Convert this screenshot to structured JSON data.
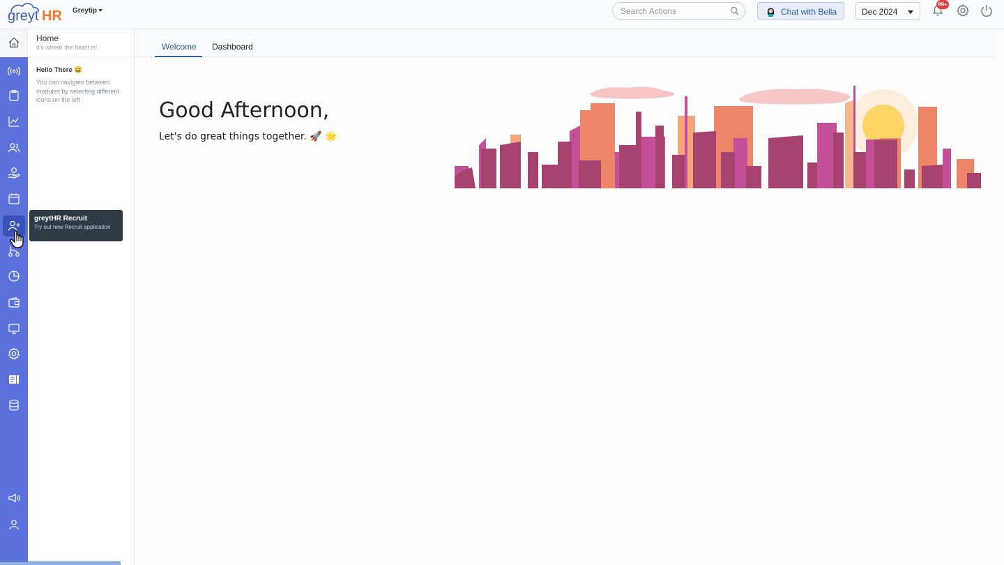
{
  "header": {
    "logo_text_a": "greyt",
    "logo_text_b": "HR",
    "org_name": "Greytip",
    "search_placeholder": "Search Actions",
    "chat_label": "Chat with Bella",
    "month_value": "Dec 2024",
    "notification_badge": "99+"
  },
  "sidebar": {
    "icons": [
      "home-icon",
      "broadcast-icon",
      "clipboard-icon",
      "chart-line-icon",
      "people-icon",
      "hand-coin-icon",
      "calendar-icon",
      "user-add-icon",
      "flow-icon",
      "pie-chart-icon",
      "wallet-icon",
      "monitor-icon",
      "settings-cog-icon",
      "document-list-icon",
      "database-icon",
      "megaphone-icon",
      "user-icon"
    ],
    "active": "user-add-icon"
  },
  "panel": {
    "title": "Home",
    "subtitle": "it's where the heart is!",
    "hello": "Hello There 😀",
    "description": "You can navigate between modules by selecting different icons on the left"
  },
  "tooltip": {
    "title": "greytHR Recruit",
    "description": "Try out new Recruit application"
  },
  "tabs": [
    {
      "label": "Welcome",
      "active": true
    },
    {
      "label": "Dashboard",
      "active": false
    }
  ],
  "main": {
    "greeting": "Good Afternoon,",
    "tagline": "Let's do great things together. 🚀 🌟"
  },
  "colors": {
    "rail": "#5b72dc",
    "accent": "#2b5aa8",
    "skyline_dark": "#a6426e",
    "skyline_pink": "#c5509a",
    "skyline_coral": "#ee8468",
    "sun": "#fdd565"
  }
}
